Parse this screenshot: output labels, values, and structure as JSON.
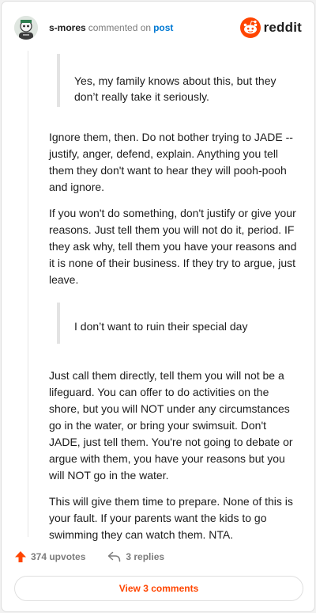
{
  "header": {
    "username": "s-mores",
    "action": "commented on",
    "post_link": "post",
    "brand": "reddit"
  },
  "comment": {
    "quote1": "Yes, my family knows about this, but they don’t really take it seriously.",
    "para1": "Ignore them, then. Do not bother trying to JADE -- justify, anger, defend, explain. Anything you tell them they don't want to hear they will pooh-pooh and ignore.",
    "para2": "If you won't do something, don't justify or give your reasons. Just tell them you will not do it, period. IF they ask why, tell them you have your reasons and it is none of their business. If they try to argue, just leave.",
    "quote2": "I don’t want to ruin their special day",
    "para3": "Just call them directly, tell them you will not be a lifeguard. You can offer to do activities on the shore, but you will NOT under any circumstances go in the water, or bring your swimsuit. Don't JADE, just tell them. You're not going to debate or argue with them, you have your reasons but you will NOT go in the water.",
    "para4": "This will give them time to prepare. None of this is your fault. If your parents want the kids to go swimming they can watch them. NTA."
  },
  "footer": {
    "upvotes": "374 upvotes",
    "replies": "3 replies",
    "view_comments": "View 3 comments"
  },
  "colors": {
    "brand_orange": "#ff4500",
    "link_blue": "#0079d3",
    "muted_text": "#7c7c7c"
  },
  "icons": {
    "avatar": "user-avatar",
    "brand": "reddit-logo-icon",
    "upvote": "upvote-arrow-icon",
    "reply": "reply-arrow-icon"
  }
}
